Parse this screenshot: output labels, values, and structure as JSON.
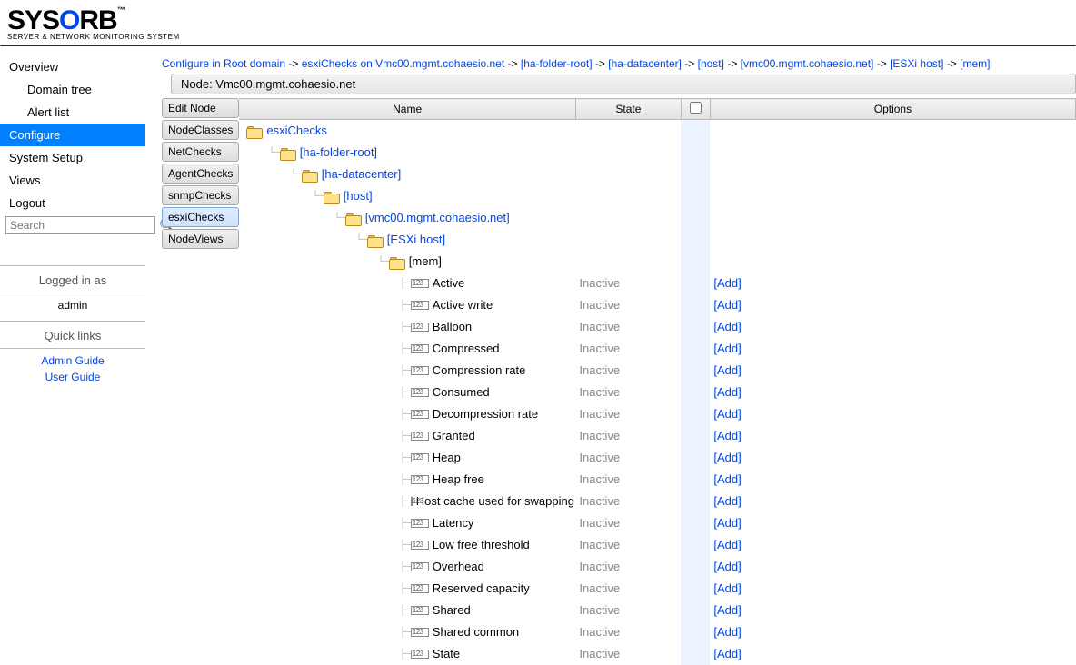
{
  "logo": {
    "brand_pre": "SYS",
    "brand_mid": "O",
    "brand_post": "RB",
    "tm": "™",
    "tagline": "SERVER & NETWORK MONITORING SYSTEM"
  },
  "sidebar": {
    "overview": "Overview",
    "domain_tree": "Domain tree",
    "alert_list": "Alert list",
    "configure": "Configure",
    "system_setup": "System Setup",
    "views": "Views",
    "logout": "Logout",
    "search_placeholder": "Search",
    "logged_in_as": "Logged in as",
    "user": "admin",
    "quick_links_head": "Quick links",
    "admin_guide": "Admin Guide",
    "user_guide": "User Guide"
  },
  "breadcrumb": {
    "parts": [
      "Configure in Root domain",
      "esxiChecks on Vmc00.mgmt.cohaesio.net",
      "[ha-folder-root]",
      "[ha-datacenter]",
      "[host]",
      "[vmc00.mgmt.cohaesio.net]",
      "[ESXi host]",
      "[mem]"
    ],
    "sep": " -> "
  },
  "node_bar": "Node: Vmc00.mgmt.cohaesio.net",
  "side_tabs": {
    "edit_node": "Edit Node",
    "node_classes": "NodeClasses",
    "net_checks": "NetChecks",
    "agent_checks": "AgentChecks",
    "snmp_checks": "snmpChecks",
    "esxi_checks": "esxiChecks",
    "node_views": "NodeViews"
  },
  "columns": {
    "name": "Name",
    "state": "State",
    "options": "Options"
  },
  "option_add": "[Add]",
  "state_inactive": "Inactive",
  "tree": {
    "l0": "esxiChecks",
    "l1": "[ha-folder-root]",
    "l2": "[ha-datacenter]",
    "l3": "[host]",
    "l4": "[vmc00.mgmt.cohaesio.net]",
    "l5": "[ESXi host]",
    "l6": "[mem]",
    "leaves": [
      "Active",
      "Active write",
      "Balloon",
      "Compressed",
      "Compression rate",
      "Consumed",
      "Decompression rate",
      "Granted",
      "Heap",
      "Heap free",
      "Host cache used for swapping",
      "Latency",
      "Low free threshold",
      "Overhead",
      "Reserved capacity",
      "Shared",
      "Shared common",
      "State"
    ]
  }
}
